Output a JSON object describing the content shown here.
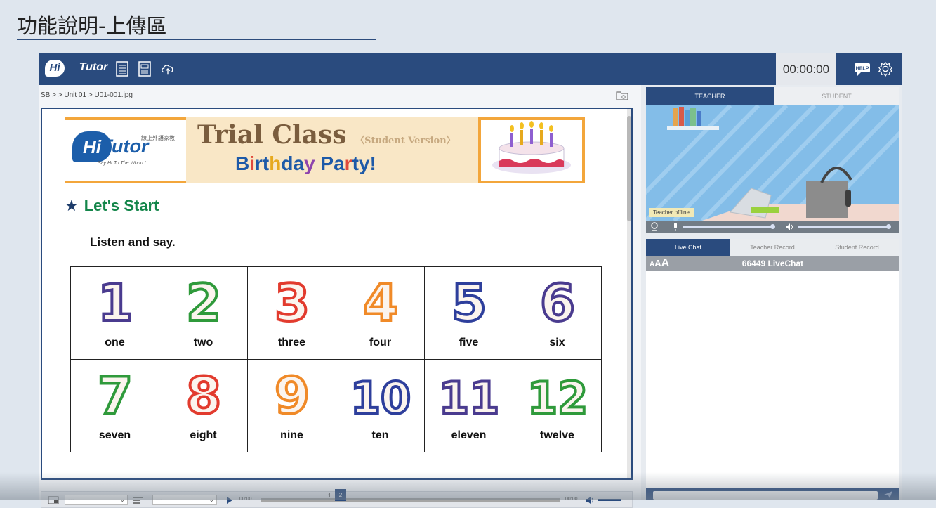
{
  "slide": {
    "title": "功能說明-上傳區"
  },
  "topbar": {
    "logo_mark": "Hi",
    "logo_text": "Tutor",
    "icons": [
      "book-list-icon",
      "worksheet-icon",
      "upload-cloud-icon",
      "help-icon",
      "settings-gear-icon"
    ],
    "timer": "00:00:00",
    "help_badge": "HELP"
  },
  "book": {
    "breadcrumb": "SB >  > Unit 01 > U01-001.jpg",
    "banner": {
      "logo_hi": "Hi",
      "logo_tutor": "Tutor",
      "logo_cn": "線上外語家教",
      "logo_slogan": "Say HI To The World !",
      "title": "Trial Class",
      "subtitle": "〈Student Version〉",
      "party_title": "Birthday Party!",
      "party_colors": [
        "#1e5aa8",
        "#e0493c",
        "#1e5aa8",
        "#1e5aa8",
        "#e6a91e",
        "#1e5aa8",
        "#1e5aa8",
        "#8e44ad",
        "#1e5aa8",
        "#1e5aa8",
        "#1e5aa8",
        "#e0493c",
        "#1e5aa8",
        "#1e5aa8"
      ]
    },
    "section": {
      "star": "★",
      "title": "Let's Start"
    },
    "instruction": "Listen and say.",
    "numbers": [
      {
        "digit": "1",
        "word": "one",
        "color": "#4a3b8f"
      },
      {
        "digit": "2",
        "word": "two",
        "color": "#2f9a3b"
      },
      {
        "digit": "3",
        "word": "three",
        "color": "#e23b2e"
      },
      {
        "digit": "4",
        "word": "four",
        "color": "#f08a28"
      },
      {
        "digit": "5",
        "word": "five",
        "color": "#2e3f9c"
      },
      {
        "digit": "6",
        "word": "six",
        "color": "#4a3b8f"
      },
      {
        "digit": "7",
        "word": "seven",
        "color": "#2f9a3b"
      },
      {
        "digit": "8",
        "word": "eight",
        "color": "#e23b2e"
      },
      {
        "digit": "9",
        "word": "nine",
        "color": "#f08a28"
      },
      {
        "digit": "10",
        "word": "ten",
        "color": "#2e3f9c"
      },
      {
        "digit": "11",
        "word": "eleven",
        "color": "#4a3b8f"
      },
      {
        "digit": "12",
        "word": "twelve",
        "color": "#2f9a3b"
      }
    ]
  },
  "media": {
    "select_1": "---",
    "select_2": "---",
    "time_start": "00:00",
    "time_end": "00:00"
  },
  "pager": {
    "page_1": "1",
    "page_2": "2"
  },
  "side": {
    "tab_teacher": "TEACHER",
    "tab_student": "STUDENT",
    "teacher_status": "Teacher offline",
    "chat_tabs": [
      "Live Chat",
      "Teacher Record",
      "Student Record"
    ],
    "font_size_label": "AAA",
    "chat_title": "66449 LiveChat"
  },
  "colors": {
    "primary": "#2a4b7e",
    "green": "#14864a",
    "orange": "#f3a63b"
  }
}
